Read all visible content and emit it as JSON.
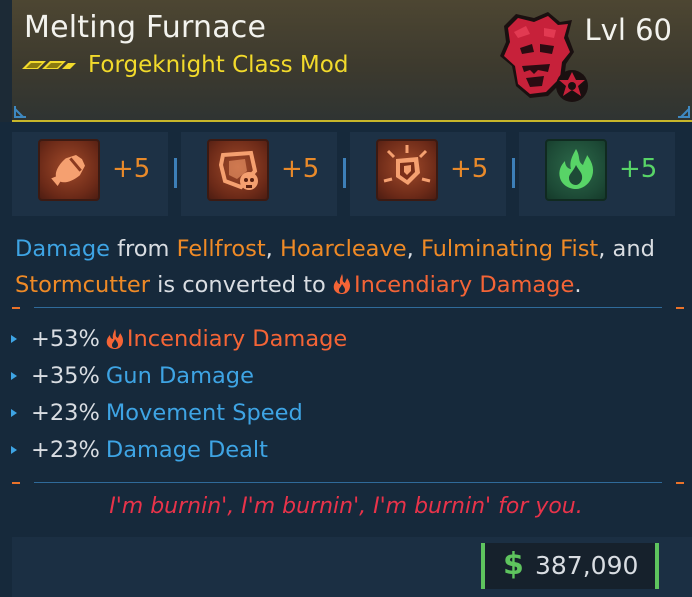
{
  "item": {
    "name": "Melting Furnace",
    "type": "Forgeknight Class Mod",
    "level": "Lvl 60",
    "rarity_color": "#f2da2b"
  },
  "skills": [
    {
      "icon": "rocket-skill-icon",
      "bonus": "+5",
      "color": "orange"
    },
    {
      "icon": "skull-shield-skill-icon",
      "bonus": "+5",
      "color": "orange"
    },
    {
      "icon": "burst-shield-skill-icon",
      "bonus": "+5",
      "color": "orange"
    },
    {
      "icon": "green-flame-skill-icon",
      "bonus": "+5",
      "color": "green"
    }
  ],
  "description": {
    "w1": "Damage",
    "t1": " from ",
    "s1": "Fellfrost",
    "t2": ", ",
    "s2": "Hoarcleave",
    "t3": ", ",
    "s3": "Fulminating Fist",
    "t4": ", and ",
    "s4": "Stormcutter",
    "t5": " is converted to ",
    "element": "Incendiary Damage",
    "t6": "."
  },
  "stats": [
    {
      "value": "+53%",
      "label": "Incendiary Damage",
      "kind": "fire"
    },
    {
      "value": "+35%",
      "label": "Gun Damage",
      "kind": "blue"
    },
    {
      "value": "+23%",
      "label": "Movement Speed",
      "kind": "blue"
    },
    {
      "value": "+23%",
      "label": "Damage Dealt",
      "kind": "blue"
    }
  ],
  "flavor": "I'm burnin', I'm burnin', I'm burnin' for you.",
  "price": {
    "currency": "$",
    "amount": "387,090"
  },
  "colors": {
    "accent_blue": "#3ea4e4",
    "orange": "#ef8a26",
    "fire_red": "#f46436",
    "flavor_red": "#e8334a",
    "money_green": "#5ec45e"
  }
}
